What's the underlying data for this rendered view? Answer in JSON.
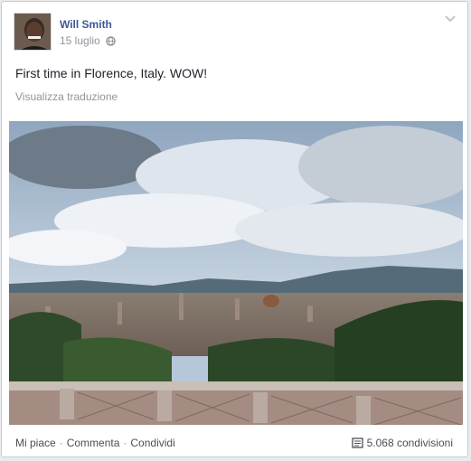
{
  "post": {
    "author": "Will Smith",
    "date": "15 luglio",
    "privacy_icon": "globe-icon",
    "text": "First time in Florence, Italy. WOW!",
    "translate_link": "Visualizza traduzione",
    "menu_icon": "chevron-down-icon"
  },
  "actions": {
    "like": "Mi piace",
    "comment": "Commenta",
    "share": "Condividi",
    "separator": "·"
  },
  "stats": {
    "shares": "5.068 condivisioni",
    "share_icon": "share-icon"
  },
  "colors": {
    "link": "#3b5998",
    "text": "#1d2129",
    "muted": "#90949c"
  }
}
